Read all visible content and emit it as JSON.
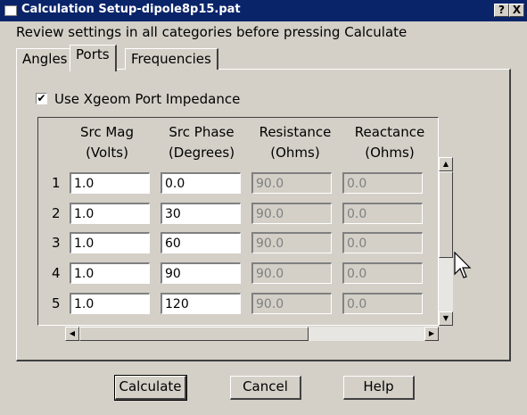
{
  "window": {
    "title": "Calculation Setup-dipole8p15.pat",
    "help_btn": "?",
    "close_btn": "X"
  },
  "instructions": "Review settings in all categories before pressing Calculate",
  "tabs": [
    {
      "label": "Angles"
    },
    {
      "label": "Ports"
    },
    {
      "label": "Frequencies"
    }
  ],
  "active_tab": "Ports",
  "option": {
    "label": "Use Xgeom Port Impedance",
    "checked": true,
    "check_glyph": "✔"
  },
  "table": {
    "columns": [
      {
        "line1": "Src Mag",
        "line2": "(Volts)"
      },
      {
        "line1": "Src Phase",
        "line2": "(Degrees)"
      },
      {
        "line1": "Resistance",
        "line2": "(Ohms)"
      },
      {
        "line1": "Reactance",
        "line2": "(Ohms)"
      }
    ],
    "rows": [
      {
        "num": "1",
        "mag": "1.0",
        "phase": "0.0",
        "res": "90.0",
        "react": "0.0"
      },
      {
        "num": "2",
        "mag": "1.0",
        "phase": "30",
        "res": "90.0",
        "react": "0.0"
      },
      {
        "num": "3",
        "mag": "1.0",
        "phase": "60",
        "res": "90.0",
        "react": "0.0"
      },
      {
        "num": "4",
        "mag": "1.0",
        "phase": "90",
        "res": "90.0",
        "react": "0.0"
      },
      {
        "num": "5",
        "mag": "1.0",
        "phase": "120",
        "res": "90.0",
        "react": "0.0"
      }
    ]
  },
  "scroll": {
    "up": "▲",
    "down": "▼",
    "left": "◀",
    "right": "▶"
  },
  "buttons": {
    "calculate": "Calculate",
    "cancel": "Cancel",
    "help": "Help"
  },
  "colors": {
    "titlebar": "#0a246a",
    "window": "#d4d0c8"
  }
}
